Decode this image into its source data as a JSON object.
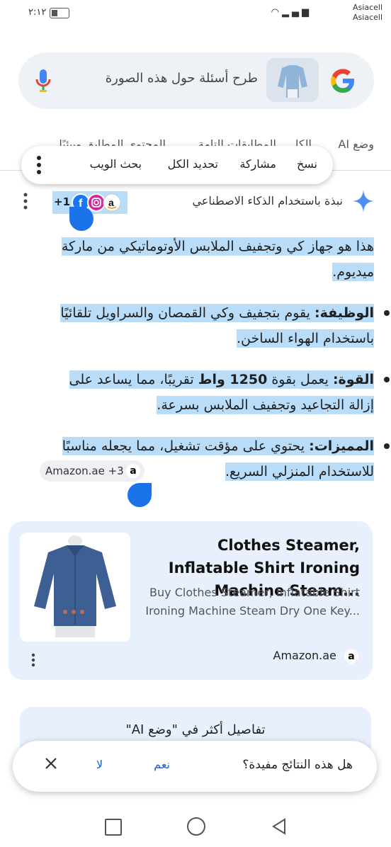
{
  "status_bar": {
    "time": "٢:١٢",
    "carrier_1": "Asiacell",
    "carrier_2": "Asiacell",
    "network": "3G"
  },
  "search": {
    "placeholder": "طرح أسئلة حول هذه الصورة"
  },
  "tabs": [
    "وضع AI",
    "الكل",
    "المطابقات التامة",
    "المحتوى المطابق وبيئيًا"
  ],
  "context_menu": {
    "items": [
      "نسخ",
      "مشاركة",
      "تحديد الكل",
      "بحث الويب"
    ]
  },
  "ai_overview": {
    "title": "نبذة باستخدام الذكاء الاصطناعي",
    "sources_more": "+1",
    "intro": "هذا هو جهاز كي وتجفيف الملابس الأوتوماتيكي من ماركة ميديوم.",
    "bullets": [
      {
        "label": "الوظيفة:",
        "text": " يقوم بتجفيف وكي القمصان والسراويل تلقائيًا باستخدام الهواء الساخن."
      },
      {
        "label": "القوة:",
        "pre": " يعمل بقوة ",
        "bold": "1250 واط",
        "text": " تقريبًا، مما يساعد على إزالة التجاعيد وتجفيف الملابس بسرعة."
      },
      {
        "label": "المميزات:",
        "text": " يحتوي على مؤقت تشغيل، مما يجعله مناسبًا للاستخدام المنزلي السريع."
      }
    ],
    "source_chip": "Amazon.ae +3"
  },
  "product_card": {
    "title": "Clothes Steamer, Inflatable Shirt Ironing Machine Steam...",
    "description": "Buy Clothes Steamer, Inflatable Shirt Ironing Machine Steam Dry One Key...",
    "source": "Amazon.ae",
    "source_badge": "a"
  },
  "more_card": {
    "text": "تفاصيل أكثر في \"وضع AI\""
  },
  "feedback": {
    "question": "هل هذه النتائج مفيدة؟",
    "yes": "نعم",
    "no": "لا"
  },
  "colors": {
    "highlight": "#b9dcf9",
    "selection_handle": "#1a73e8",
    "card_bg": "#e8f0fe",
    "link": "#1a5fc7"
  }
}
